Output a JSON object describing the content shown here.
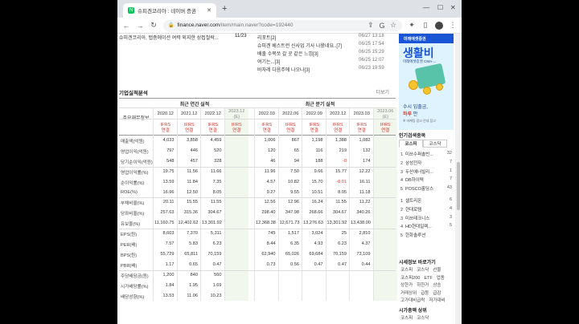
{
  "browser": {
    "tab_title": "슈피겐코리아 : 네이버 증권",
    "new_tab_glyph": "+",
    "url_host": "finance.naver.com",
    "url_path": "/item/main.naver?code=192440"
  },
  "news": {
    "left_item": {
      "text": "슈피겐코리아, 탭층에이션 여력 외지한 성접철락...",
      "date": "11/23"
    },
    "items": [
      {
        "text": "리포트[2]",
        "date": "06/27 13:18"
      },
      {
        "text": "슈피겐 베스트런 신사업 기사 나왔네요..[7]",
        "date": "06/25 17:54"
      },
      {
        "text": "배출 수복쏘 갈 곳 같은 느낌[3]",
        "date": "06/25 15:29"
      },
      {
        "text": "여기는...[3]",
        "date": "06/25 12:07"
      },
      {
        "text": "바자레 다음주에 나오나[3]",
        "date": "06/23 19:59"
      }
    ]
  },
  "financials": {
    "section_title": "기업실적분석",
    "more_label": "더보기",
    "row_header": "주요재무정보",
    "annual_header": "최근 연간 실적",
    "quarter_header": "최근 분기 실적",
    "annual_periods": [
      "2020.12",
      "2021.12",
      "2022.12",
      "2023.12"
    ],
    "quarter_periods": [
      "2022.03",
      "2022.06",
      "2022.09",
      "2022.12",
      "2023.03",
      "2023.06"
    ],
    "estimate_mark": "(E)",
    "ifrs_top": "IFRS",
    "ifrs_bottom": "연결",
    "rows": [
      {
        "label": "매출액(억원)",
        "a": [
          "4,033",
          "3,858",
          "4,459",
          ""
        ],
        "q": [
          "1,006",
          "867",
          "1,198",
          "1,388",
          "1,082",
          ""
        ]
      },
      {
        "label": "영업이익(억원)",
        "a": [
          "797",
          "446",
          "520",
          ""
        ],
        "q": [
          "120",
          "65",
          "116",
          "219",
          "132",
          ""
        ]
      },
      {
        "label": "당기순이익(억원)",
        "a": [
          "548",
          "457",
          "328",
          ""
        ],
        "q": [
          "46",
          "94",
          "188",
          "-0",
          "174",
          ""
        ]
      },
      {
        "label": "영업이익률(%)",
        "a": [
          "19.75",
          "11.56",
          "11.66",
          ""
        ],
        "q": [
          "11.96",
          "7.50",
          "9.66",
          "15.77",
          "12.22",
          ""
        ]
      },
      {
        "label": "순이익률(%)",
        "a": [
          "13.59",
          "11.84",
          "7.35",
          ""
        ],
        "q": [
          "4.57",
          "10.82",
          "15.70",
          "-0.01",
          "16.11",
          ""
        ]
      },
      {
        "label": "ROE(%)",
        "a": [
          "16.96",
          "12.50",
          "8.05",
          ""
        ],
        "q": [
          "9.27",
          "9.55",
          "10.51",
          "8.05",
          "11.18",
          ""
        ]
      },
      {
        "label": "부채비율(%)",
        "a": [
          "20.11",
          "15.55",
          "11.55",
          ""
        ],
        "q": [
          "12.56",
          "12.96",
          "16.24",
          "11.55",
          "11.22",
          ""
        ]
      },
      {
        "label": "당좌비율(%)",
        "a": [
          "257.63",
          "315.36",
          "304.67",
          ""
        ],
        "q": [
          "298.40",
          "347.98",
          "268.66",
          "304.67",
          "340.26",
          ""
        ]
      },
      {
        "label": "유보율(%)",
        "a": [
          "11,160.75",
          "12,402.62",
          "13,301.92",
          ""
        ],
        "q": [
          "12,368.38",
          "12,671.73",
          "13,276.63",
          "13,301.92",
          "13,438.00",
          ""
        ]
      },
      {
        "label": "EPS(원)",
        "a": [
          "8,603",
          "7,370",
          "5,311",
          ""
        ],
        "q": [
          "745",
          "1,517",
          "3,024",
          "25",
          "2,810",
          ""
        ]
      },
      {
        "label": "PER(배)",
        "a": [
          "7.57",
          "5.83",
          "6.23",
          ""
        ],
        "q": [
          "8.44",
          "6.35",
          "4.93",
          "6.23",
          "4.37",
          ""
        ]
      },
      {
        "label": "BPS(원)",
        "a": [
          "55,729",
          "65,811",
          "70,159",
          ""
        ],
        "q": [
          "62,940",
          "65,026",
          "69,684",
          "70,159",
          "73,109",
          ""
        ]
      },
      {
        "label": "PBR(배)",
        "a": [
          "1.17",
          "0.65",
          "0.47",
          ""
        ],
        "q": [
          "0.73",
          "0.56",
          "0.47",
          "0.47",
          "0.44",
          ""
        ]
      },
      {
        "label": "주당배당금(원)",
        "a": [
          "1,200",
          "840",
          "560",
          ""
        ],
        "q": [
          "",
          "",
          "",
          "",
          "",
          ""
        ]
      },
      {
        "label": "시가배당률(%)",
        "a": [
          "1.84",
          "1.95",
          "1.69",
          ""
        ],
        "q": [
          "",
          "",
          "",
          "",
          "",
          ""
        ]
      },
      {
        "label": "배당성향(%)",
        "a": [
          "13.53",
          "11.06",
          "10.23",
          ""
        ],
        "q": [
          "",
          "",
          "",
          "",
          "",
          ""
        ]
      }
    ]
  },
  "ad": {
    "brand": "미래에셋증권",
    "headline": "생활비",
    "sub": "미래에셋증권 CMA-...",
    "line1": "수시 입출금,",
    "line2_a": "하루",
    "line2_b": "만",
    "fine": "※ 마케팅 광고 안내 참고"
  },
  "ranking": {
    "title": "인기검색종목",
    "tabs": [
      "코스피",
      "코스닥"
    ],
    "items": [
      {
        "n": "1",
        "name": "미쓰수퍼솔빈...",
        "v": "32"
      },
      {
        "n": "2",
        "name": "삼성전자",
        "v": "7"
      },
      {
        "n": "3",
        "name": "두산에너빌리...",
        "v": "1"
      },
      {
        "n": "4",
        "name": "DB하이텍",
        "v": "7"
      },
      {
        "n": "5",
        "name": "POSCO홀딩스",
        "v": "43"
      },
      {
        "n": "1",
        "name": "셀트리온",
        "v": "6"
      },
      {
        "n": "2",
        "name": "현대로템",
        "v": "4"
      },
      {
        "n": "3",
        "name": "미쓰테크니스",
        "v": "3"
      },
      {
        "n": "4",
        "name": "HD현대일렉...",
        "v": "5"
      },
      {
        "n": "5",
        "name": "한화솔루션",
        "v": ""
      }
    ]
  },
  "market": {
    "title1": "시세정보 바로가기",
    "rows1": [
      [
        "코스피",
        "코스닥",
        "선물"
      ],
      [
        "코스피200",
        "ETF",
        "업종"
      ],
      [
        "상한가",
        "하한가",
        "상승"
      ],
      [
        "거래상위",
        "급등",
        "급감"
      ],
      [
        "고가대비급락",
        "저가대비"
      ]
    ],
    "title2": "시가총액 상위",
    "rows2": [
      [
        "코스피",
        "코스닥"
      ]
    ]
  },
  "colors": {
    "accent": "#03c75a",
    "negative": "#e0342a",
    "estimate_bg": "#f2f7ee"
  }
}
